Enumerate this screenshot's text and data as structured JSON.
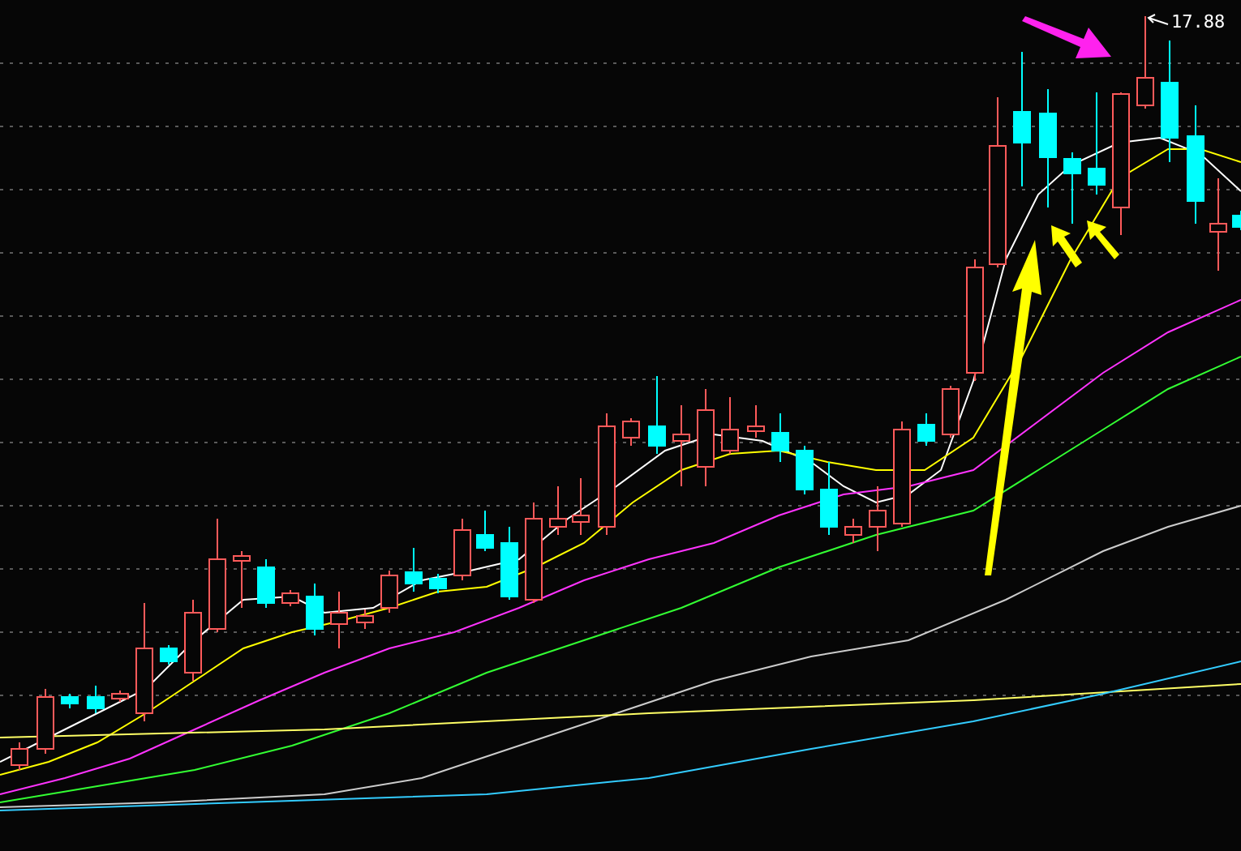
{
  "chart": {
    "peak_price_label": "17.88"
  }
}
